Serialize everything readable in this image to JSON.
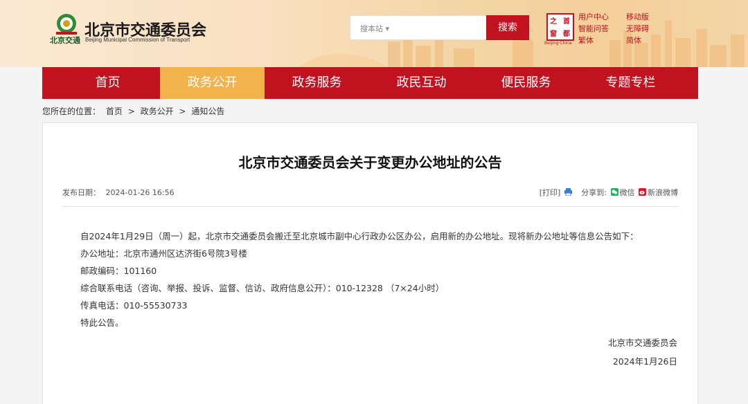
{
  "header": {
    "logo_abbr": "北京交通",
    "site_title": "北京市交通委员会",
    "site_subtitle": "Beijing Municipal Commission of Transport",
    "search_scope": "搜本站 ▾",
    "search_button": "搜索",
    "seal_chars": [
      "首",
      "都",
      "之",
      "窗"
    ],
    "seal_caption": "Beijing·China",
    "links": [
      "用户中心",
      "移动版",
      "智能问答",
      "无障碍",
      "繁体",
      "简体"
    ]
  },
  "nav": {
    "items": [
      "首页",
      "政务公开",
      "政务服务",
      "政民互动",
      "便民服务",
      "专题专栏"
    ],
    "active_index": 1
  },
  "breadcrumb": {
    "prefix": "您所在的位置：",
    "items": [
      "首页",
      ">",
      "政务公开",
      ">",
      "通知公告"
    ]
  },
  "article": {
    "title": "北京市交通委员会关于变更办公地址的公告",
    "publish_label": "发布日期：",
    "publish_date": "2024-01-26 16:56",
    "print_label": "[打印]",
    "share_label": "分享到:",
    "share_wechat": "微信",
    "share_weibo": "新浪微博",
    "paragraphs": [
      "自2024年1月29日（周一）起，北京市交通委员会搬迁至北京城市副中心行政办公区办公，启用新的办公地址。现将新办公地址等信息公告如下：",
      "办公地址：北京市通州区达济街6号院3号楼",
      "邮政编码：101160",
      "综合联系电话（咨询、举报、投诉、监督、信访、政府信息公开）：010-12328 （7×24小时）",
      "传真电话：010-55530733",
      "特此公告。"
    ],
    "signature": "北京市交通委员会",
    "sign_date": "2024年1月26日"
  },
  "colors": {
    "brand_red": "#c1121f",
    "active_tab": "#f2b24c"
  }
}
